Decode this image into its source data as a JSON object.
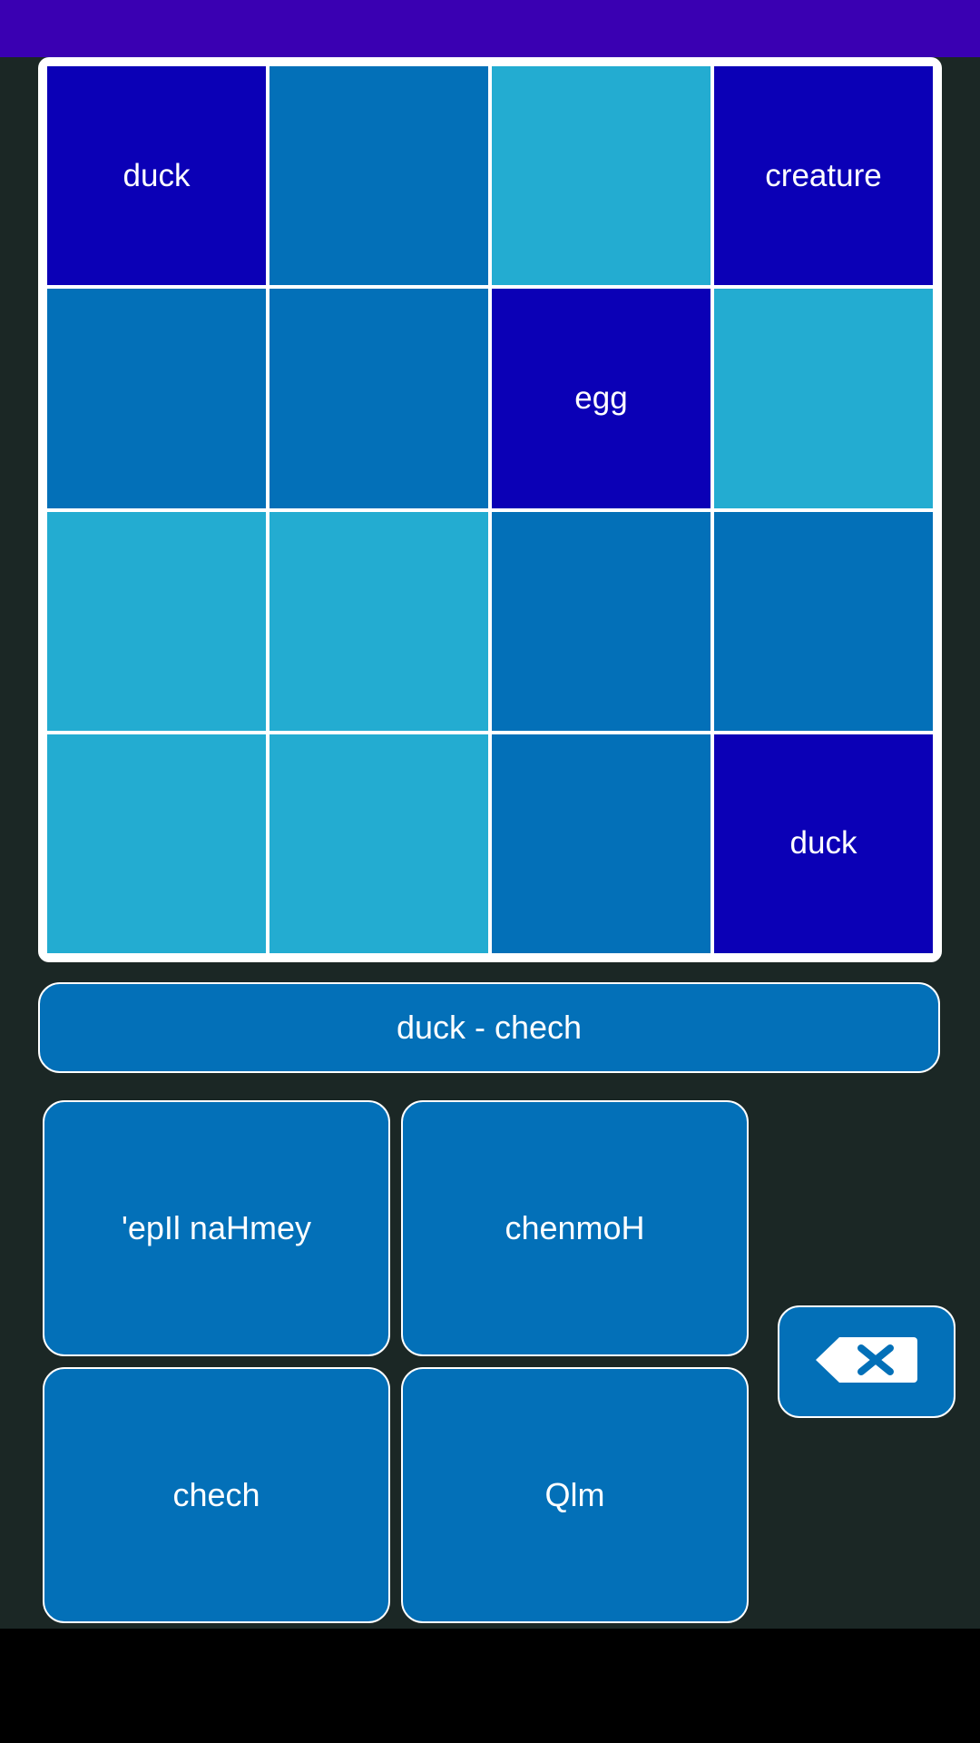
{
  "board": {
    "cells": [
      {
        "label": "duck",
        "shade": "dark"
      },
      {
        "label": "",
        "shade": "mid"
      },
      {
        "label": "",
        "shade": "light"
      },
      {
        "label": "creature",
        "shade": "dark"
      },
      {
        "label": "",
        "shade": "mid"
      },
      {
        "label": "",
        "shade": "mid"
      },
      {
        "label": "egg",
        "shade": "dark"
      },
      {
        "label": "",
        "shade": "light"
      },
      {
        "label": "",
        "shade": "light"
      },
      {
        "label": "",
        "shade": "light"
      },
      {
        "label": "",
        "shade": "mid"
      },
      {
        "label": "",
        "shade": "mid"
      },
      {
        "label": "",
        "shade": "light"
      },
      {
        "label": "",
        "shade": "light"
      },
      {
        "label": "",
        "shade": "mid"
      },
      {
        "label": "duck",
        "shade": "dark"
      }
    ]
  },
  "current_pair": "duck - chech",
  "answers": [
    "'epIl naHmey",
    "chenmoH",
    "chech",
    "Qlm"
  ],
  "backspace_icon": "backspace-icon",
  "colors": {
    "status_bar": "#3a00b2",
    "background": "#1b2725",
    "tile_dark": "#0b00b6",
    "tile_mid": "#0370b8",
    "tile_light": "#23acd1",
    "button": "#0370b8"
  }
}
